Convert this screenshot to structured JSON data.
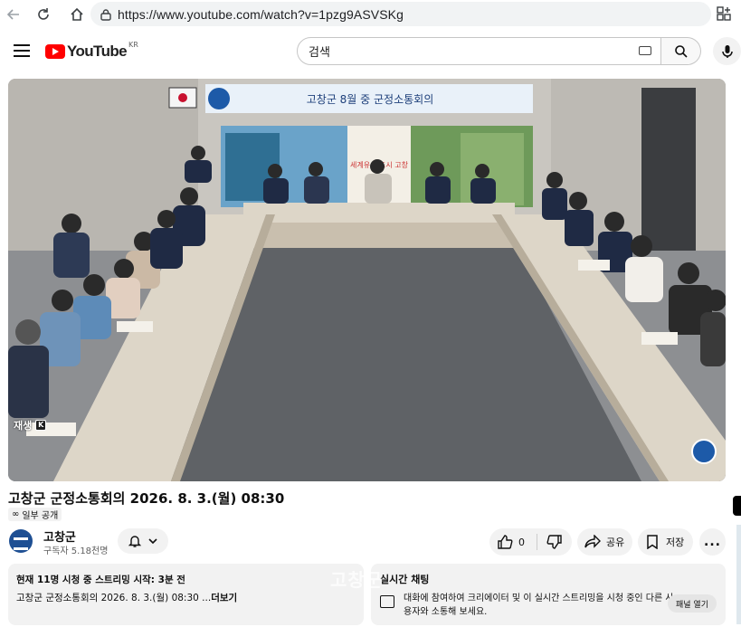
{
  "browser": {
    "url": "https://www.youtube.com/watch?v=1pzg9ASVSKg"
  },
  "header": {
    "logo_text": "YouTube",
    "region": "KR",
    "search_placeholder": "검색"
  },
  "video": {
    "banner_title": "고창군 8월 중 군정소통회의",
    "slogan": "세계유산 도시 고창",
    "replay_label": "재생",
    "replay_key": "K"
  },
  "details": {
    "title": "고창군 군정소통회의 2026. 8. 3.(월) 08:30",
    "visibility": "일부 공개",
    "channel_name": "고창군",
    "subscribers": "구독자 5.18천명",
    "like_count": "0",
    "share_label": "공유",
    "save_label": "저장",
    "more_label": "..."
  },
  "description": {
    "meta": "현재 11명 시청 중  스트리밍 시작: 3분 전",
    "text": "고창군 군정소통회의 2026. 8. 3.(월) 08:30 ...",
    "more_link": "더보기"
  },
  "chat": {
    "title": "실시간 채팅",
    "message": "대화에 참여하여 크리에이터 및 이 실시간 스트리밍을 시청 중인 다른 사용자와 소통해 보세요.",
    "open_label": "패널 열기",
    "watermark": "고창군"
  },
  "colors": {
    "brand_red": "#ff0000",
    "surface": "#f2f2f2",
    "text": "#0f0f0f"
  }
}
